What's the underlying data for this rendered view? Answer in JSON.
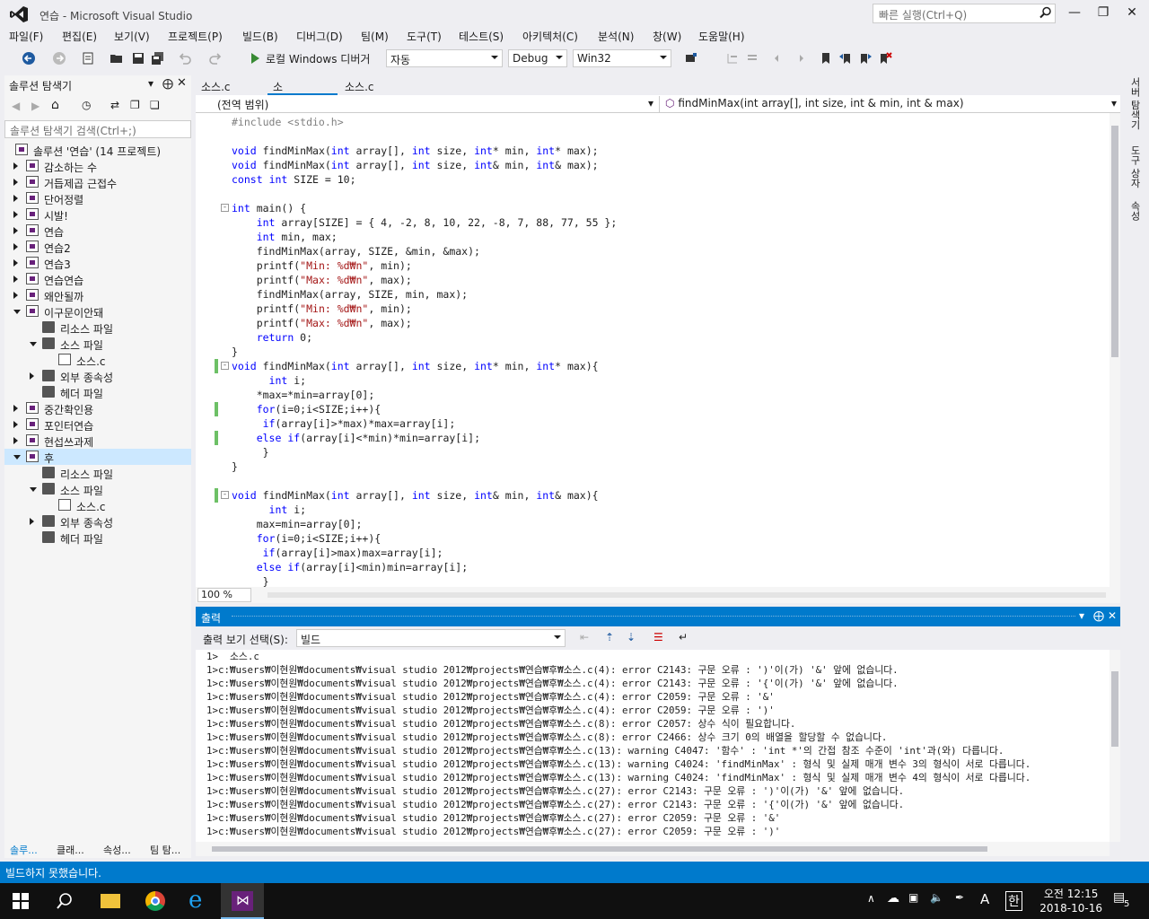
{
  "window": {
    "title": "연습 - Microsoft Visual Studio",
    "quick_launch_placeholder": "빠른 실행(Ctrl+Q)"
  },
  "menu": [
    "파일(F)",
    "편집(E)",
    "보기(V)",
    "프로젝트(P)",
    "빌드(B)",
    "디버그(D)",
    "팀(M)",
    "도구(T)",
    "테스트(S)",
    "아키텍처(C)",
    "분석(N)",
    "창(W)",
    "도움말(H)"
  ],
  "toolbar": {
    "run_label": "로컬 Windows 디버거",
    "config_auto": "자동",
    "config_build": "Debug",
    "config_platform": "Win32"
  },
  "solution_explorer": {
    "title": "솔루션 탐색기",
    "search_placeholder": "솔루션 탐색기 검색(Ctrl+;)",
    "items": [
      {
        "label": "솔루션 '연습' (14 프로젝트)",
        "level": 0,
        "expand": "none",
        "type": "solution"
      },
      {
        "label": "감소하는 수",
        "level": 1,
        "expand": "closed",
        "type": "project"
      },
      {
        "label": "거듭제곱 근접수",
        "level": 1,
        "expand": "closed",
        "type": "project"
      },
      {
        "label": "단어정렬",
        "level": 1,
        "expand": "closed",
        "type": "project"
      },
      {
        "label": "시발!",
        "level": 1,
        "expand": "closed",
        "type": "project"
      },
      {
        "label": "연습",
        "level": 1,
        "expand": "closed",
        "type": "project"
      },
      {
        "label": "연습2",
        "level": 1,
        "expand": "closed",
        "type": "project"
      },
      {
        "label": "연습3",
        "level": 1,
        "expand": "closed",
        "type": "project"
      },
      {
        "label": "연습연습",
        "level": 1,
        "expand": "closed",
        "type": "project"
      },
      {
        "label": "왜안될까",
        "level": 1,
        "expand": "closed",
        "type": "project"
      },
      {
        "label": "이구문이안돼",
        "level": 1,
        "expand": "open",
        "type": "project"
      },
      {
        "label": "리소스 파일",
        "level": 2,
        "expand": "none",
        "type": "folder"
      },
      {
        "label": "소스 파일",
        "level": 2,
        "expand": "open",
        "type": "folder"
      },
      {
        "label": "소스.c",
        "level": 3,
        "expand": "none",
        "type": "file"
      },
      {
        "label": "외부 종속성",
        "level": 2,
        "expand": "closed",
        "type": "folder"
      },
      {
        "label": "헤더 파일",
        "level": 2,
        "expand": "none",
        "type": "folder"
      },
      {
        "label": "중간확인용",
        "level": 1,
        "expand": "closed",
        "type": "project"
      },
      {
        "label": "포인터연습",
        "level": 1,
        "expand": "closed",
        "type": "project"
      },
      {
        "label": "현섭쓰과제",
        "level": 1,
        "expand": "closed",
        "type": "project"
      },
      {
        "label": "후",
        "level": 1,
        "expand": "open",
        "type": "project",
        "selected": true
      },
      {
        "label": "리소스 파일",
        "level": 2,
        "expand": "none",
        "type": "folder"
      },
      {
        "label": "소스 파일",
        "level": 2,
        "expand": "open",
        "type": "folder"
      },
      {
        "label": "소스.c",
        "level": 3,
        "expand": "none",
        "type": "file"
      },
      {
        "label": "외부 종속성",
        "level": 2,
        "expand": "closed",
        "type": "folder"
      },
      {
        "label": "헤더 파일",
        "level": 2,
        "expand": "none",
        "type": "folder"
      }
    ],
    "bottom_tabs": [
      "솔루...",
      "클래...",
      "속성...",
      "팀 탐..."
    ]
  },
  "editor": {
    "tabs": [
      "소스.c",
      "소스.c",
      "소스.c"
    ],
    "active_tab": 1,
    "scope": "(전역 범위)",
    "member": "findMinMax(int array[], int size, int & min, int & max)",
    "zoom": "100 %",
    "lines": [
      {
        "text": "#include <stdio.h>",
        "pp": true
      },
      {
        "text": ""
      },
      {
        "text": "void findMinMax(int array[], int size, int* min, int* max);"
      },
      {
        "text": "void findMinMax(int array[], int size, int& min, int& max);"
      },
      {
        "text": "const int SIZE = 10;"
      },
      {
        "text": ""
      },
      {
        "text": "int main() {",
        "fold": true
      },
      {
        "text": "    int array[SIZE] = { 4, -2, 8, 10, 22, -8, 7, 88, 77, 55 };"
      },
      {
        "text": "    int min, max;"
      },
      {
        "text": "    findMinMax(array, SIZE, &min, &max);"
      },
      {
        "text": "    printf(\"Min: %d₩n\", min);"
      },
      {
        "text": "    printf(\"Max: %d₩n\", max);"
      },
      {
        "text": "    findMinMax(array, SIZE, min, max);"
      },
      {
        "text": "    printf(\"Min: %d₩n\", min);"
      },
      {
        "text": "    printf(\"Max: %d₩n\", max);"
      },
      {
        "text": "    return 0;"
      },
      {
        "text": "}"
      },
      {
        "text": "void findMinMax(int array[], int size, int* min, int* max){",
        "fold": true,
        "green": true
      },
      {
        "text": "      int i;"
      },
      {
        "text": "    *max=*min=array[0];"
      },
      {
        "text": "    for(i=0;i<SIZE;i++){",
        "green": true
      },
      {
        "text": "     if(array[i]>*max)*max=array[i];"
      },
      {
        "text": "    else if(array[i]<*min)*min=array[i];",
        "green": true
      },
      {
        "text": "     }"
      },
      {
        "text": "}"
      },
      {
        "text": ""
      },
      {
        "text": "void findMinMax(int array[], int size, int& min, int& max){",
        "fold": true,
        "green": true
      },
      {
        "text": "      int i;"
      },
      {
        "text": "    max=min=array[0];"
      },
      {
        "text": "    for(i=0;i<SIZE;i++){"
      },
      {
        "text": "     if(array[i]>max)max=array[i];"
      },
      {
        "text": "    else if(array[i]<min)min=array[i];"
      },
      {
        "text": "     }"
      }
    ]
  },
  "output": {
    "title": "출력",
    "show_from_label": "출력 보기 선택(S):",
    "show_from_value": "빌드",
    "lines": [
      "1>  소스.c",
      "1>c:₩users₩이현원₩documents₩visual studio 2012₩projects₩연습₩후₩소스.c(4): error C2143: 구문 오류 : ')'이(가) '&' 앞에 없습니다.",
      "1>c:₩users₩이현원₩documents₩visual studio 2012₩projects₩연습₩후₩소스.c(4): error C2143: 구문 오류 : '{'이(가) '&' 앞에 없습니다.",
      "1>c:₩users₩이현원₩documents₩visual studio 2012₩projects₩연습₩후₩소스.c(4): error C2059: 구문 오류 : '&'",
      "1>c:₩users₩이현원₩documents₩visual studio 2012₩projects₩연습₩후₩소스.c(4): error C2059: 구문 오류 : ')'",
      "1>c:₩users₩이현원₩documents₩visual studio 2012₩projects₩연습₩후₩소스.c(8): error C2057: 상수 식이 필요합니다.",
      "1>c:₩users₩이현원₩documents₩visual studio 2012₩projects₩연습₩후₩소스.c(8): error C2466: 상수 크기 0의 배열을 할당할 수 없습니다.",
      "1>c:₩users₩이현원₩documents₩visual studio 2012₩projects₩연습₩후₩소스.c(13): warning C4047: '함수' : 'int *'의 간접 참조 수준이 'int'과(와) 다릅니다.",
      "1>c:₩users₩이현원₩documents₩visual studio 2012₩projects₩연습₩후₩소스.c(13): warning C4024: 'findMinMax' : 형식 및 실제 매개 변수 3의 형식이 서로 다릅니다.",
      "1>c:₩users₩이현원₩documents₩visual studio 2012₩projects₩연습₩후₩소스.c(13): warning C4024: 'findMinMax' : 형식 및 실제 매개 변수 4의 형식이 서로 다릅니다.",
      "1>c:₩users₩이현원₩documents₩visual studio 2012₩projects₩연습₩후₩소스.c(27): error C2143: 구문 오류 : ')'이(가) '&' 앞에 없습니다.",
      "1>c:₩users₩이현원₩documents₩visual studio 2012₩projects₩연습₩후₩소스.c(27): error C2143: 구문 오류 : '{'이(가) '&' 앞에 없습니다.",
      "1>c:₩users₩이현원₩documents₩visual studio 2012₩projects₩연습₩후₩소스.c(27): error C2059: 구문 오류 : '&'",
      "1>c:₩users₩이현원₩documents₩visual studio 2012₩projects₩연습₩후₩소스.c(27): error C2059: 구문 오류 : ')'"
    ]
  },
  "right_rail": [
    "서버 탐색기",
    "도구 상자",
    "속성"
  ],
  "status": {
    "text": "빌드하지 못했습니다."
  },
  "taskbar": {
    "time": "오전 12:15",
    "date": "2018-10-16",
    "ime": "A",
    "ime2": "한",
    "notifications": "5"
  },
  "colors": {
    "accent": "#007acc",
    "keyword": "#0000ff",
    "string": "#a31515",
    "vs_purple": "#68217a"
  }
}
